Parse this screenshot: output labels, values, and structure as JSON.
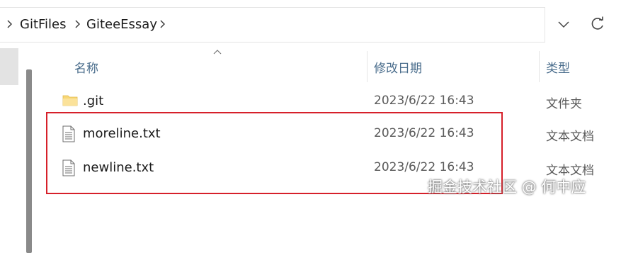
{
  "breadcrumb": {
    "items": [
      "GitFiles",
      "GiteeEssay"
    ]
  },
  "columns": {
    "name": "名称",
    "date": "修改日期",
    "type": "类型"
  },
  "files": [
    {
      "name": ".git",
      "date": "2023/6/22 16:43",
      "type": "文件夹",
      "icon": "folder-icon"
    },
    {
      "name": "moreline.txt",
      "date": "2023/6/22 16:43",
      "type": "文本文档",
      "icon": "text-file-icon"
    },
    {
      "name": "newline.txt",
      "date": "2023/6/22 16:43",
      "type": "文本文档",
      "icon": "text-file-icon"
    }
  ],
  "watermark": "掘金技术社区 @ 何中应",
  "colors": {
    "highlight": "#d6202a",
    "folder": "#f8d775",
    "header_text": "#4a6d8c"
  }
}
